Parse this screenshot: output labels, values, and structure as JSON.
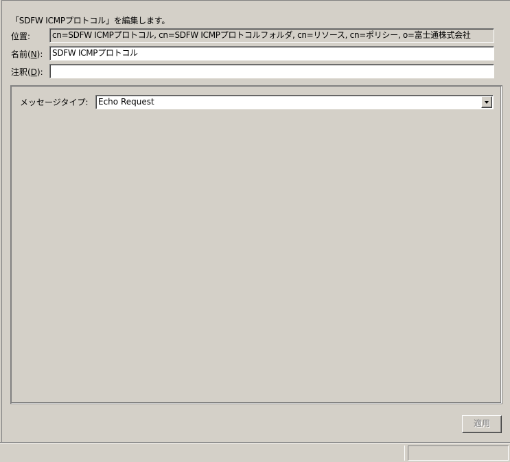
{
  "dialog": {
    "header": "「SDFW ICMPプロトコル」を編集します。"
  },
  "fields": {
    "location_label": "位置:",
    "location_value": "cn=SDFW ICMPプロトコル, cn=SDFW ICMPプロトコルフォルダ, cn=リソース, cn=ポリシー, o=富士通株式会社",
    "name_label_prefix": "名前(",
    "name_label_key": "N",
    "name_label_suffix": "):",
    "name_value": "SDFW ICMPプロトコル",
    "comment_label_prefix": "注釈(",
    "comment_label_key": "D",
    "comment_label_suffix": "):",
    "comment_value": ""
  },
  "message_type": {
    "label": "メッセージタイプ:",
    "selected": "Echo Request",
    "icon": "chevron-down-icon"
  },
  "buttons": {
    "apply_label": "適用",
    "apply_enabled": false
  },
  "status_bar": {
    "main_text": "",
    "right_text": ""
  }
}
